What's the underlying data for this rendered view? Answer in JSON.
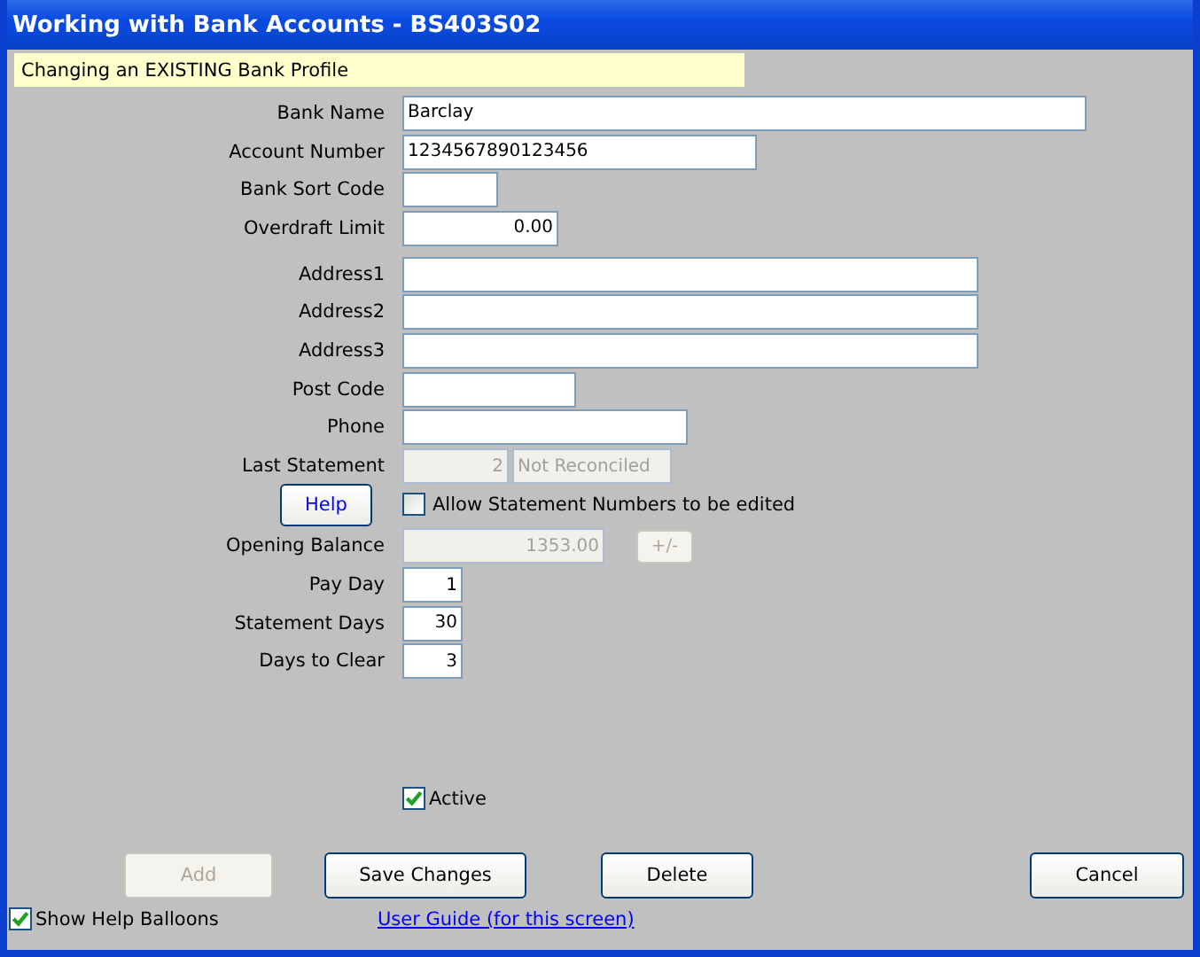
{
  "window": {
    "title": "Working with Bank Accounts - BS403S02"
  },
  "banner": "Changing an EXISTING Bank Profile",
  "rows": [
    {
      "kind": "field",
      "label": "Bank Name",
      "inputs": [
        {
          "value": "Barclay",
          "kind": "text",
          "disabled": false
        }
      ]
    },
    {
      "kind": "field",
      "label": "Account Number",
      "inputs": [
        {
          "value": "1234567890123456",
          "kind": "text",
          "disabled": false
        }
      ]
    },
    {
      "kind": "field",
      "label": "Bank Sort Code",
      "inputs": [
        {
          "kind": "text",
          "disabled": false
        }
      ]
    },
    {
      "kind": "field",
      "label": "Overdraft Limit",
      "inputs": [
        {
          "value": "0.00",
          "kind": "number",
          "disabled": false
        }
      ]
    },
    {
      "kind": "field",
      "label": "Address1",
      "inputs": [
        {
          "kind": "text",
          "disabled": false
        }
      ]
    },
    {
      "kind": "field",
      "label": "Address2",
      "inputs": [
        {
          "kind": "text",
          "disabled": false
        }
      ]
    },
    {
      "kind": "field",
      "label": "Address3",
      "inputs": [
        {
          "kind": "text",
          "disabled": false
        }
      ]
    },
    {
      "kind": "field",
      "label": "Post Code",
      "inputs": [
        {
          "kind": "text",
          "disabled": false
        }
      ]
    },
    {
      "kind": "field",
      "label": "Phone",
      "inputs": [
        {
          "kind": "text",
          "disabled": false
        }
      ]
    },
    {
      "kind": "field",
      "label": "Last Statement",
      "inputs": [
        {
          "value": "2",
          "kind": "number",
          "disabled": true
        },
        {
          "value": "Not Reconciled",
          "kind": "text",
          "disabled": true
        }
      ]
    },
    {
      "kind": "help",
      "button": "Help",
      "checkbox": {
        "label": "Allow Statement Numbers to be edited",
        "checked": false
      }
    },
    {
      "kind": "field",
      "label": "Opening Balance",
      "inputs": [
        {
          "value": "1353.00",
          "kind": "number",
          "disabled": true
        }
      ],
      "button": {
        "label": "+/-",
        "disabled": true
      }
    },
    {
      "kind": "field",
      "label": "Pay Day",
      "inputs": [
        {
          "value": "1",
          "kind": "number",
          "disabled": false
        }
      ]
    },
    {
      "kind": "field",
      "label": "Statement Days",
      "inputs": [
        {
          "value": "30",
          "kind": "number",
          "disabled": false
        }
      ]
    },
    {
      "kind": "field",
      "label": "Days to Clear",
      "inputs": [
        {
          "value": "3",
          "kind": "number",
          "disabled": false
        }
      ]
    }
  ],
  "active": {
    "label": "Active",
    "checked": true
  },
  "buttons": [
    {
      "label": "Add",
      "disabled": true
    },
    {
      "label": "Save Changes",
      "disabled": false
    },
    {
      "label": "Delete",
      "disabled": false
    },
    {
      "label": "Cancel",
      "disabled": false
    }
  ],
  "show_help": {
    "label": "Show Help Balloons",
    "checked": true
  },
  "link": "User Guide (for this screen)"
}
